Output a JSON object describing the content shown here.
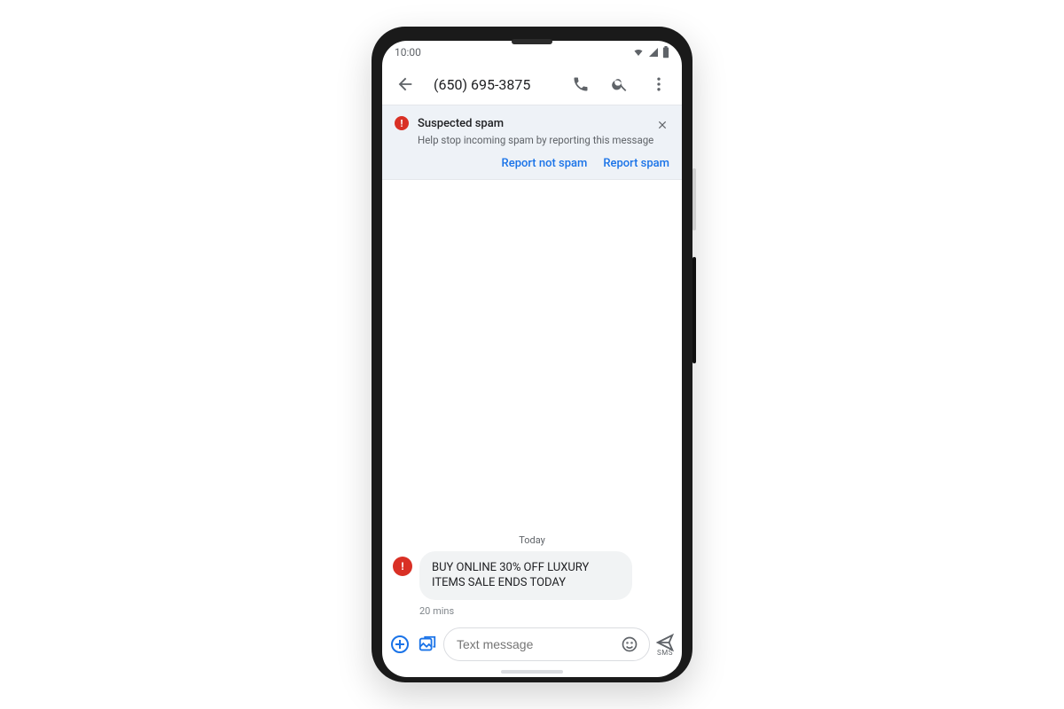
{
  "status_bar": {
    "time": "10:00"
  },
  "app_bar": {
    "phone_number": "(650) 695-3875"
  },
  "spam_banner": {
    "title": "Suspected spam",
    "subtitle": "Help stop incoming spam by reporting this message",
    "action_not_spam": "Report not spam",
    "action_spam": "Report spam"
  },
  "conversation": {
    "date_label": "Today",
    "message_text": "BUY ONLINE 30% OFF LUXURY ITEMS SALE ENDS TODAY",
    "message_time": "20 mins"
  },
  "composer": {
    "placeholder": "Text message",
    "send_mode": "SMS"
  }
}
